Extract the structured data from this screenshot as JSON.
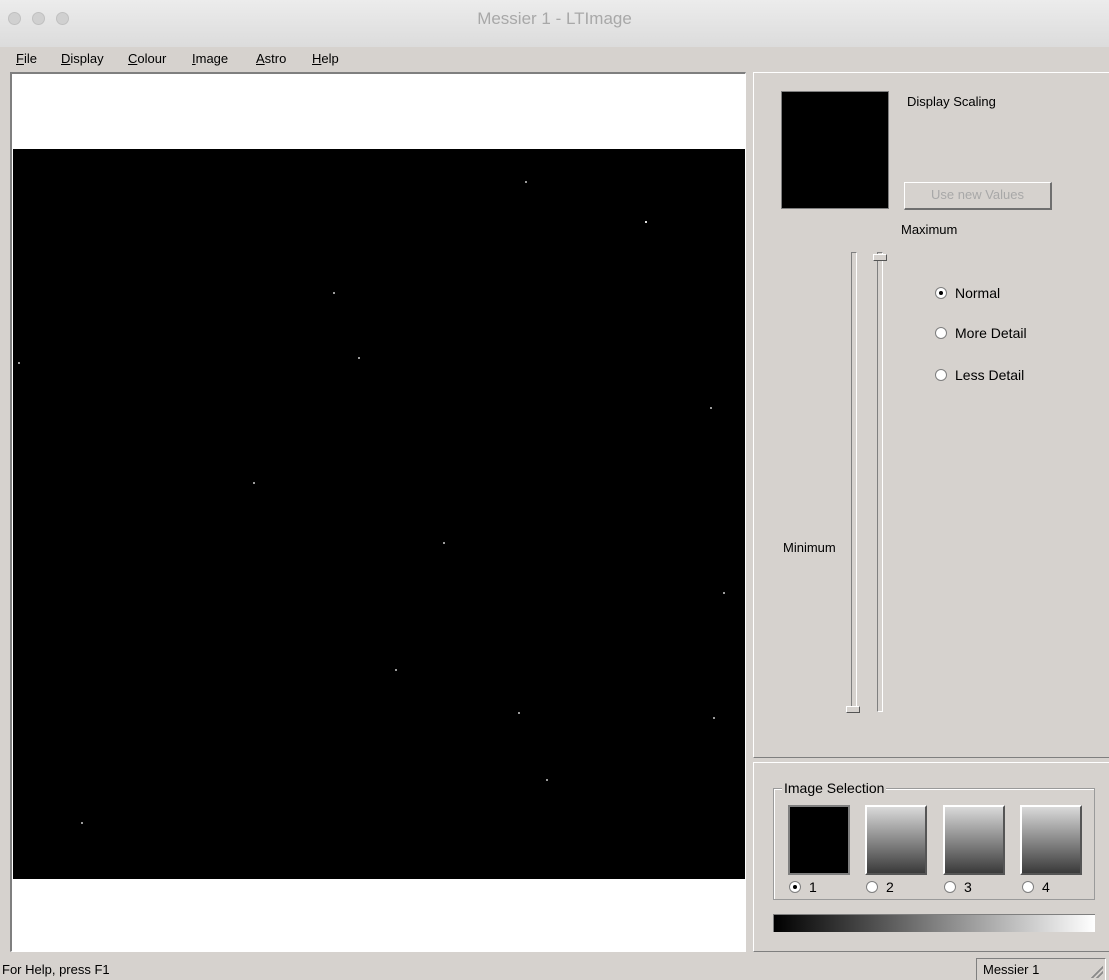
{
  "window": {
    "title": "Messier 1 - LTImage"
  },
  "menu": {
    "items": [
      {
        "ul": "F",
        "rest": "ile"
      },
      {
        "ul": "D",
        "rest": "isplay"
      },
      {
        "ul": "C",
        "rest": "olour"
      },
      {
        "ul": "I",
        "rest": "mage"
      },
      {
        "ul": "A",
        "rest": "stro"
      },
      {
        "ul": "H",
        "rest": "elp"
      }
    ]
  },
  "scaling": {
    "title": "Display Scaling",
    "use_button": "Use new Values",
    "maximum_label": "Maximum",
    "minimum_label": "Minimum",
    "modes": [
      {
        "label": "Normal",
        "checked": true
      },
      {
        "label": "More Detail",
        "checked": false
      },
      {
        "label": "Less Detail",
        "checked": false
      }
    ]
  },
  "selection": {
    "title": "Image Selection",
    "items": [
      {
        "label": "1",
        "checked": true
      },
      {
        "label": "2",
        "checked": false
      },
      {
        "label": "3",
        "checked": false
      },
      {
        "label": "4",
        "checked": false
      }
    ]
  },
  "status": {
    "help": "For Help, press F1",
    "pane": "Messier 1"
  }
}
